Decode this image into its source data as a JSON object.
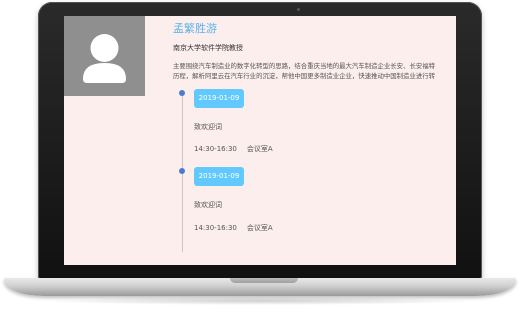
{
  "profile": {
    "name": "孟繁胜游",
    "position": "南京大学软件学院教授",
    "bio_lines": [
      "主要围绕汽车制造业的数字化转型的思路，结合重庆当地的最大汽车制造企业长安、长安福特",
      "历程，解析阿里云在汽车行业的沉淀，帮他中国更多制造业企业，快速推动中国制造业进行转"
    ]
  },
  "timeline": [
    {
      "date": "2019-01-09",
      "title": "致欢迎词",
      "time": "14:30-16:30",
      "room": "会议室A"
    },
    {
      "date": "2019-01-09",
      "title": "致欢迎词",
      "time": "14:30-16:30",
      "room": "会议室A"
    }
  ],
  "colors": {
    "screen_bg": "#fdeeee",
    "accent": "#62c9ff",
    "name_color": "#5ab4e6",
    "dot": "#4a7bd0",
    "avatar_bg": "#8f8f8f"
  }
}
